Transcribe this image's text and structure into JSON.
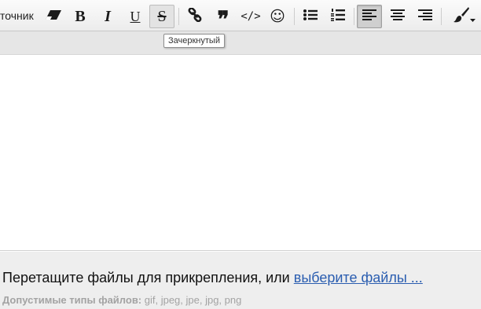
{
  "toolbar": {
    "source_label": "точник",
    "buttons": [
      {
        "name": "remove-format",
        "icon": "eraser-icon"
      },
      {
        "name": "bold",
        "glyph": "B"
      },
      {
        "name": "italic",
        "glyph": "I"
      },
      {
        "name": "underline",
        "glyph": "U"
      },
      {
        "name": "strikethrough",
        "glyph": "S"
      },
      {
        "name": "link",
        "icon": "link-icon"
      },
      {
        "name": "quote",
        "glyph": "❞"
      },
      {
        "name": "code",
        "glyph": "</>"
      },
      {
        "name": "smilies",
        "glyph": "☺"
      },
      {
        "name": "bulleted-list",
        "icon": "bullet-list-icon"
      },
      {
        "name": "numbered-list",
        "icon": "numbered-list-icon"
      },
      {
        "name": "align-left",
        "icon": "align-left-icon",
        "active": true
      },
      {
        "name": "align-center",
        "icon": "align-center-icon"
      },
      {
        "name": "align-right",
        "icon": "align-right-icon"
      },
      {
        "name": "text-color",
        "icon": "brush-icon"
      }
    ],
    "hovered": "strikethrough",
    "active": "align-left"
  },
  "tooltip": {
    "text": "Зачеркнутый"
  },
  "editor": {
    "content": ""
  },
  "attachments": {
    "drop_text": "Перетащите файлы для прикрепления, или ",
    "choose_link": "выберите файлы ...",
    "allowed_label": "Допустимые типы файлов:",
    "allowed_types": " gif, jpeg, jpe, jpg, png"
  },
  "colors": {
    "link": "#2a5db0",
    "toolbar_bg": "#f1f1f1",
    "dropzone_bg": "#eeeeee",
    "muted_text": "#a3a3a3"
  }
}
